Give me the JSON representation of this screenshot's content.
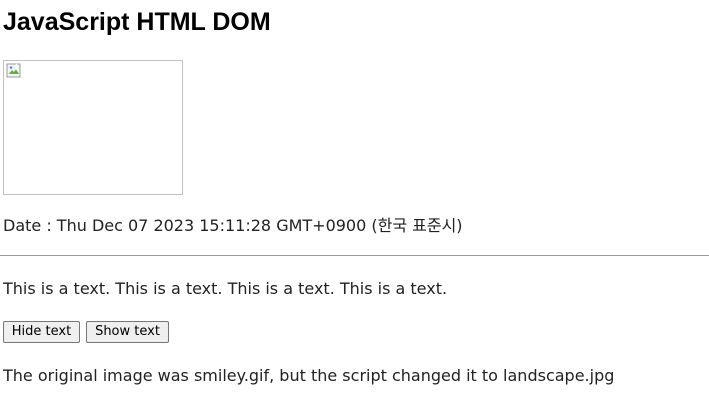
{
  "page": {
    "heading": "JavaScript HTML DOM",
    "image_icon": "broken-image-icon",
    "date_text": "Date : Thu Dec 07 2023 15:11:28 GMT+0900 (한국 표준시)",
    "paragraph": "This is a text. This is a text. This is a text. This is a text.",
    "buttons": {
      "hide_label": "Hide text",
      "show_label": "Show text"
    },
    "note": "The original image was smiley.gif, but the script changed it to landscape.jpg"
  }
}
